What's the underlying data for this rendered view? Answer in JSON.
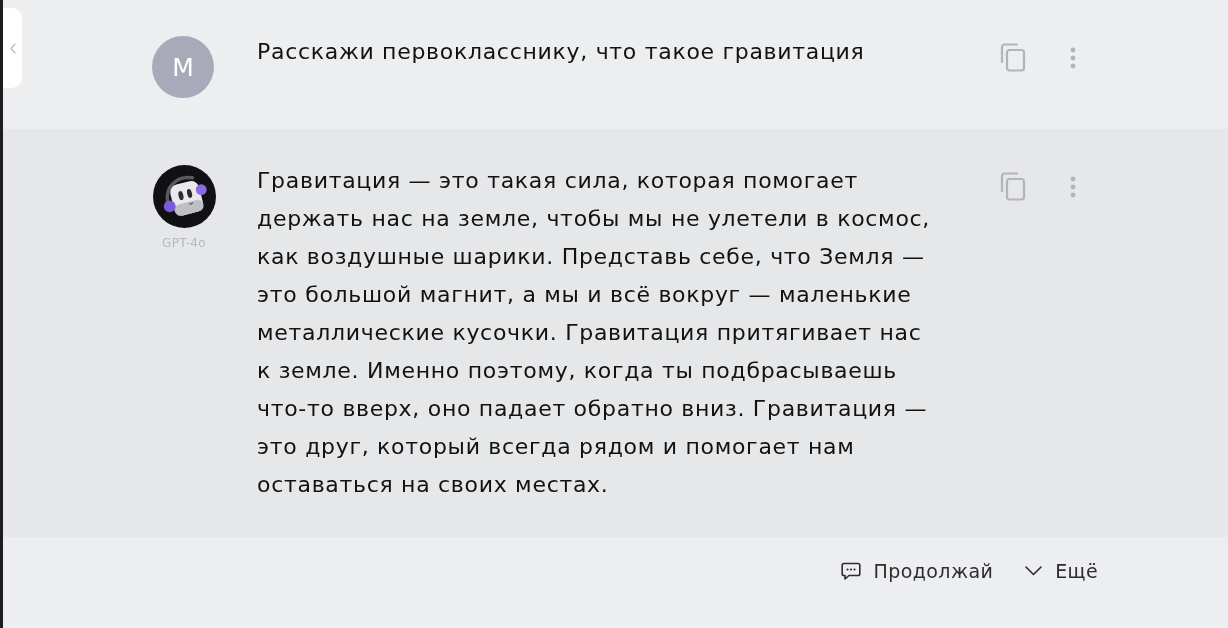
{
  "messages": [
    {
      "kind": "user",
      "avatar_letter": "M",
      "text": "Расскажи первокласснику, что такое гравитация"
    },
    {
      "kind": "assistant",
      "model_label": "GPT-4o",
      "text": "Гравитация — это такая сила, которая помогает держать нас на земле, чтобы мы не улетели в космос, как воздушные шарики. Представь себе, что Земля — это большой магнит, а мы и всё вокруг — маленькие металлические кусочки. Гравитация притягивает нас к земле. Именно поэтому, когда ты подбрасываешь что-то вверх, оно падает обратно вниз. Гравитация — это друг, который всегда рядом и помогает нам оставаться на своих местах."
    }
  ],
  "footer_actions": [
    {
      "kind": "continue",
      "label": "Продолжай"
    },
    {
      "kind": "more",
      "label": "Ещё"
    }
  ]
}
